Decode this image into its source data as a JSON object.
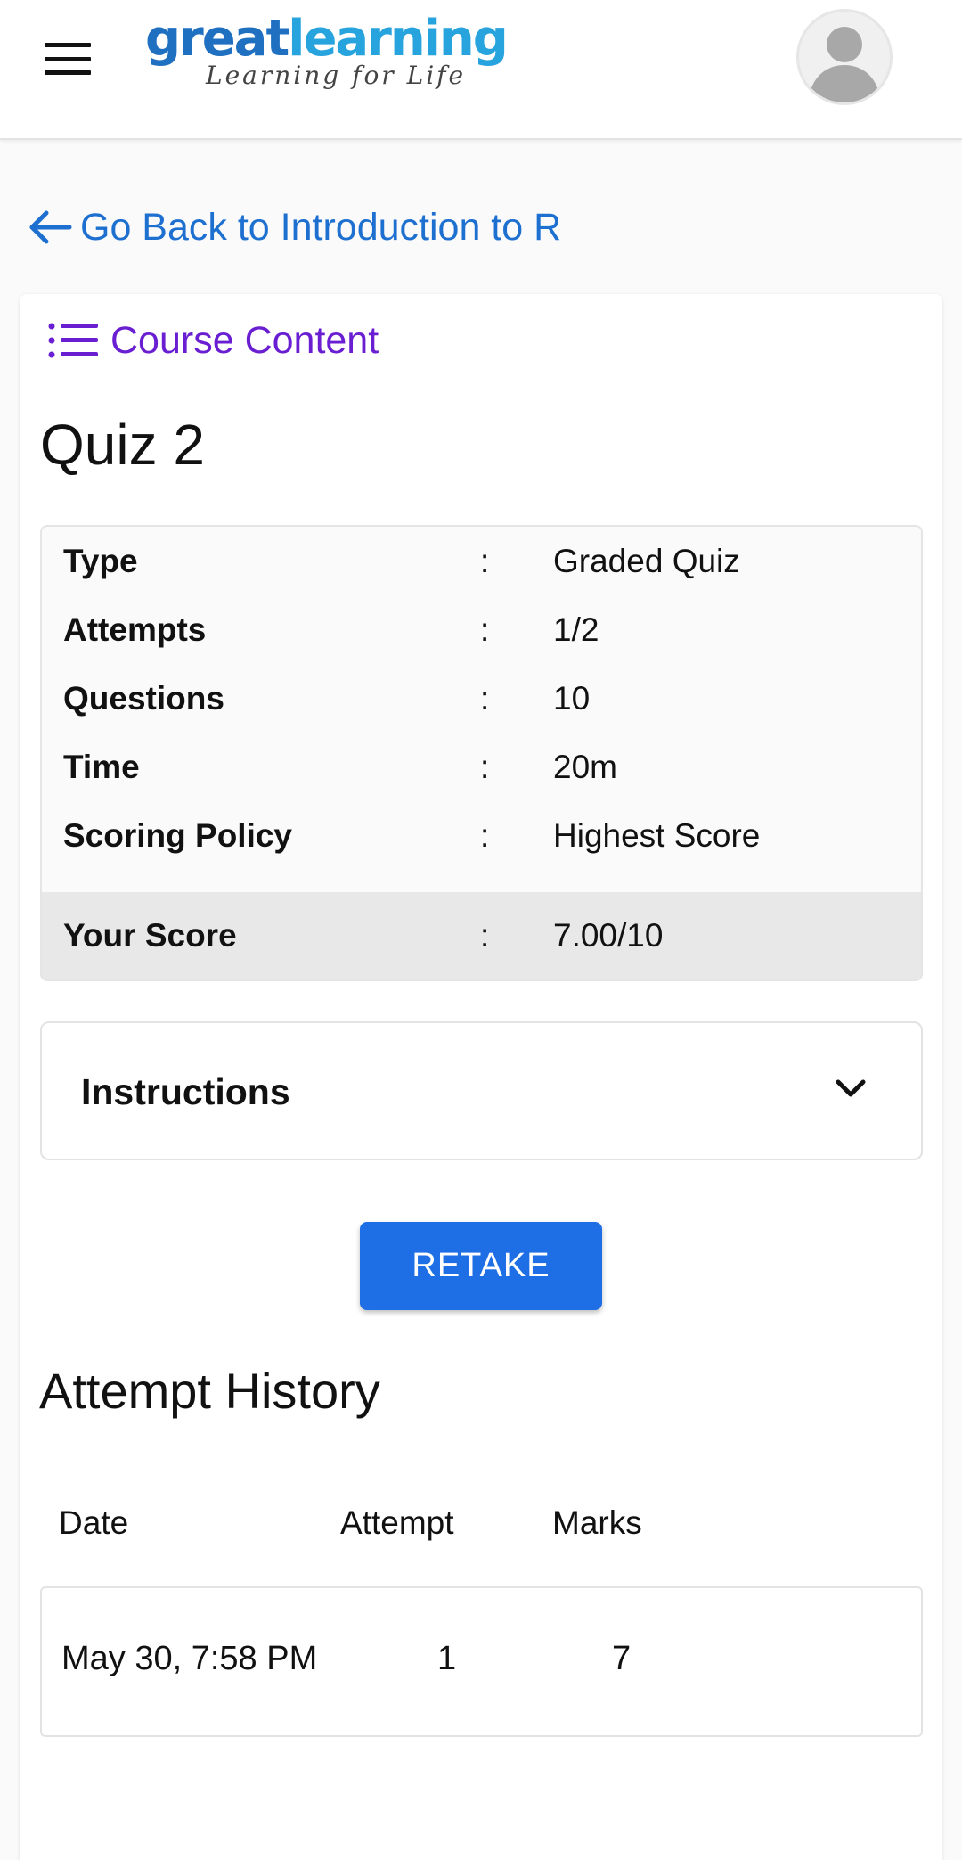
{
  "header": {
    "logo_main_a": "great",
    "logo_main_b": "learning",
    "logo_tagline": "Learning for Life",
    "menu_icon": "hamburger-menu-icon",
    "avatar_icon": "user-avatar-icon"
  },
  "back_link": {
    "label": "Go Back to Introduction to R",
    "icon": "arrow-left-icon"
  },
  "course_content": {
    "label": "Course Content",
    "icon": "list-icon"
  },
  "quiz": {
    "title": "Quiz 2",
    "details": [
      {
        "key": "Type",
        "sep": ":",
        "value": "Graded Quiz"
      },
      {
        "key": "Attempts",
        "sep": ":",
        "value": "1/2"
      },
      {
        "key": "Questions",
        "sep": ":",
        "value": "10"
      },
      {
        "key": "Time",
        "sep": ":",
        "value": "20m"
      },
      {
        "key": "Scoring Policy",
        "sep": ":",
        "value": "Highest Score"
      }
    ],
    "score": {
      "key": "Your Score",
      "sep": ":",
      "value": "7.00/10"
    }
  },
  "instructions": {
    "label": "Instructions",
    "icon": "chevron-down-icon"
  },
  "retake_label": "RETAKE",
  "history": {
    "title": "Attempt History",
    "columns": [
      "Date",
      "Attempt",
      "Marks"
    ],
    "rows": [
      {
        "date": "May 30, 7:58 PM",
        "attempt": "1",
        "marks": "7"
      }
    ]
  },
  "colors": {
    "link_blue": "#1d6fd0",
    "purple": "#6a1ed2",
    "button_blue": "#1e6ee6",
    "logo_dark_blue": "#1f70c1",
    "logo_light_blue": "#27a3dd"
  }
}
